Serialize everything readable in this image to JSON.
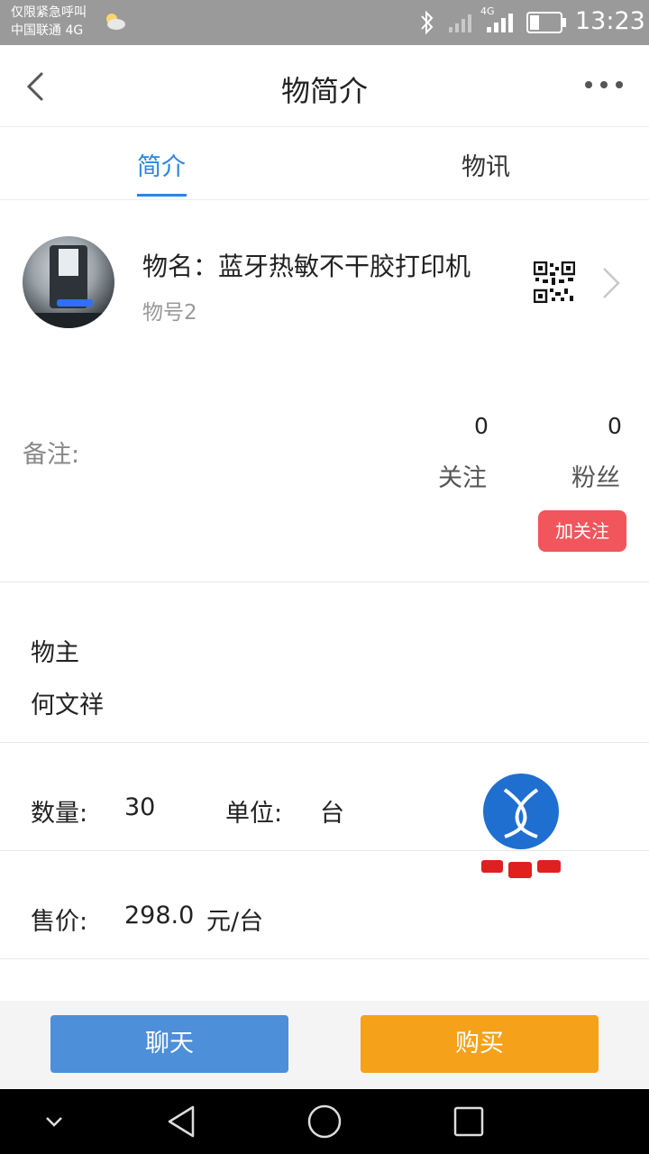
{
  "status_bar": {
    "line1": "仅限紧急呼叫",
    "line2": "中国联通 4G",
    "network": "4G",
    "time": "13:23"
  },
  "header": {
    "title": "物简介"
  },
  "tabs": [
    {
      "label": "简介",
      "active": true
    },
    {
      "label": "物讯",
      "active": false
    }
  ],
  "item": {
    "name": "物名：蓝牙热敏不干胶打印机",
    "number": "物号2"
  },
  "notes": {
    "label": "备注:"
  },
  "stats": {
    "follow_count": "0",
    "follow_label": "关注",
    "fans_count": "0",
    "fans_label": "粉丝",
    "follow_button": "加关注"
  },
  "owner": {
    "label": "物主",
    "name": "何文祥"
  },
  "quantity": {
    "label": "数量:",
    "value": "30",
    "unit_label": "单位:",
    "unit_value": "台"
  },
  "price": {
    "label": "售价:",
    "value": "298.0",
    "unit": "元/台"
  },
  "actions": {
    "chat": "聊天",
    "buy": "购买"
  },
  "colors": {
    "accent": "#2b86e0",
    "follow_button": "#f0565c",
    "chat_button": "#4d8fd8",
    "buy_button": "#f5a11a"
  }
}
